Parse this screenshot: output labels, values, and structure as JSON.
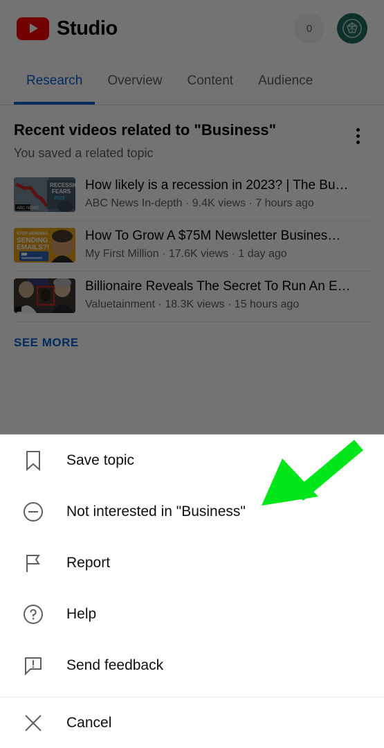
{
  "header": {
    "brand_name": "Studio",
    "logo_icon": "youtube-play-icon",
    "notification_count": "0",
    "avatar_icon": "channel-avatar",
    "logo_color": "#ff0000",
    "avatar_color": "#1f6b5e"
  },
  "tabs": {
    "active_color": "#065fd4",
    "items": [
      {
        "label": "Research",
        "active": true
      },
      {
        "label": "Overview",
        "active": false
      },
      {
        "label": "Content",
        "active": false
      },
      {
        "label": "Audience",
        "active": false
      }
    ]
  },
  "research_card": {
    "title": "Recent videos related to \"Business\"",
    "subtitle": "You saved a related topic",
    "menu_icon": "more-vertical-icon",
    "see_more_label": "SEE MORE",
    "see_more_color": "#065fd4",
    "videos": [
      {
        "title": "How likely is a recession in 2023? | The Bu…",
        "meta": "ABC News In-depth · 9.4K views · 7 hours ago",
        "channel": "ABC News In-depth",
        "views": "9.4K views",
        "age": "7 hours ago",
        "thumbnail": "recession-chart-thumbnail"
      },
      {
        "title": "How To Grow A $75M Newsletter Busines…",
        "meta": "My First Million · 17.6K views · 1 day ago",
        "channel": "My First Million",
        "views": "17.6K views",
        "age": "1 day ago",
        "thumbnail": "sending-emails-thumbnail"
      },
      {
        "title": "Billionaire Reveals The Secret To Run An E…",
        "meta": "Valuetainment · 18.3K views · 15 hours ago",
        "channel": "Valuetainment",
        "views": "18.3K views",
        "age": "15 hours ago",
        "thumbnail": "interview-thumbnail"
      }
    ]
  },
  "bottom_sheet": {
    "items": [
      {
        "label": "Save topic",
        "icon": "bookmark-icon"
      },
      {
        "label": "Not interested in \"Business\"",
        "icon": "minus-circle-icon"
      },
      {
        "label": "Report",
        "icon": "flag-icon"
      },
      {
        "label": "Help",
        "icon": "help-circle-icon"
      },
      {
        "label": "Send feedback",
        "icon": "feedback-icon"
      }
    ],
    "cancel": {
      "label": "Cancel",
      "icon": "close-icon"
    }
  },
  "annotation": {
    "type": "arrow",
    "color": "#00e61a",
    "points_to": "Not interested in \"Business\""
  }
}
